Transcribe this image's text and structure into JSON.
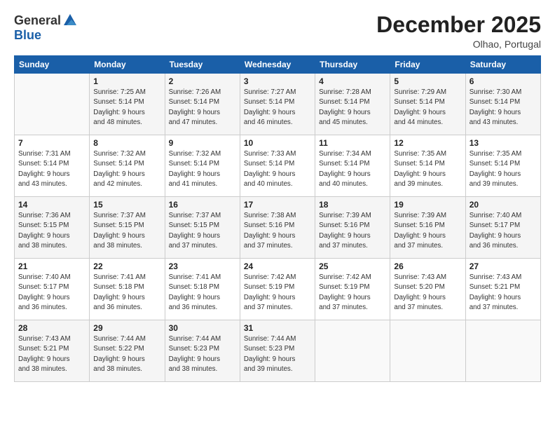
{
  "header": {
    "logo_general": "General",
    "logo_blue": "Blue",
    "month_title": "December 2025",
    "subtitle": "Olhao, Portugal"
  },
  "weekdays": [
    "Sunday",
    "Monday",
    "Tuesday",
    "Wednesday",
    "Thursday",
    "Friday",
    "Saturday"
  ],
  "weeks": [
    [
      {
        "day": "",
        "info": ""
      },
      {
        "day": "1",
        "info": "Sunrise: 7:25 AM\nSunset: 5:14 PM\nDaylight: 9 hours\nand 48 minutes."
      },
      {
        "day": "2",
        "info": "Sunrise: 7:26 AM\nSunset: 5:14 PM\nDaylight: 9 hours\nand 47 minutes."
      },
      {
        "day": "3",
        "info": "Sunrise: 7:27 AM\nSunset: 5:14 PM\nDaylight: 9 hours\nand 46 minutes."
      },
      {
        "day": "4",
        "info": "Sunrise: 7:28 AM\nSunset: 5:14 PM\nDaylight: 9 hours\nand 45 minutes."
      },
      {
        "day": "5",
        "info": "Sunrise: 7:29 AM\nSunset: 5:14 PM\nDaylight: 9 hours\nand 44 minutes."
      },
      {
        "day": "6",
        "info": "Sunrise: 7:30 AM\nSunset: 5:14 PM\nDaylight: 9 hours\nand 43 minutes."
      }
    ],
    [
      {
        "day": "7",
        "info": "Sunrise: 7:31 AM\nSunset: 5:14 PM\nDaylight: 9 hours\nand 43 minutes."
      },
      {
        "day": "8",
        "info": "Sunrise: 7:32 AM\nSunset: 5:14 PM\nDaylight: 9 hours\nand 42 minutes."
      },
      {
        "day": "9",
        "info": "Sunrise: 7:32 AM\nSunset: 5:14 PM\nDaylight: 9 hours\nand 41 minutes."
      },
      {
        "day": "10",
        "info": "Sunrise: 7:33 AM\nSunset: 5:14 PM\nDaylight: 9 hours\nand 40 minutes."
      },
      {
        "day": "11",
        "info": "Sunrise: 7:34 AM\nSunset: 5:14 PM\nDaylight: 9 hours\nand 40 minutes."
      },
      {
        "day": "12",
        "info": "Sunrise: 7:35 AM\nSunset: 5:14 PM\nDaylight: 9 hours\nand 39 minutes."
      },
      {
        "day": "13",
        "info": "Sunrise: 7:35 AM\nSunset: 5:14 PM\nDaylight: 9 hours\nand 39 minutes."
      }
    ],
    [
      {
        "day": "14",
        "info": "Sunrise: 7:36 AM\nSunset: 5:15 PM\nDaylight: 9 hours\nand 38 minutes."
      },
      {
        "day": "15",
        "info": "Sunrise: 7:37 AM\nSunset: 5:15 PM\nDaylight: 9 hours\nand 38 minutes."
      },
      {
        "day": "16",
        "info": "Sunrise: 7:37 AM\nSunset: 5:15 PM\nDaylight: 9 hours\nand 37 minutes."
      },
      {
        "day": "17",
        "info": "Sunrise: 7:38 AM\nSunset: 5:16 PM\nDaylight: 9 hours\nand 37 minutes."
      },
      {
        "day": "18",
        "info": "Sunrise: 7:39 AM\nSunset: 5:16 PM\nDaylight: 9 hours\nand 37 minutes."
      },
      {
        "day": "19",
        "info": "Sunrise: 7:39 AM\nSunset: 5:16 PM\nDaylight: 9 hours\nand 37 minutes."
      },
      {
        "day": "20",
        "info": "Sunrise: 7:40 AM\nSunset: 5:17 PM\nDaylight: 9 hours\nand 36 minutes."
      }
    ],
    [
      {
        "day": "21",
        "info": "Sunrise: 7:40 AM\nSunset: 5:17 PM\nDaylight: 9 hours\nand 36 minutes."
      },
      {
        "day": "22",
        "info": "Sunrise: 7:41 AM\nSunset: 5:18 PM\nDaylight: 9 hours\nand 36 minutes."
      },
      {
        "day": "23",
        "info": "Sunrise: 7:41 AM\nSunset: 5:18 PM\nDaylight: 9 hours\nand 36 minutes."
      },
      {
        "day": "24",
        "info": "Sunrise: 7:42 AM\nSunset: 5:19 PM\nDaylight: 9 hours\nand 37 minutes."
      },
      {
        "day": "25",
        "info": "Sunrise: 7:42 AM\nSunset: 5:19 PM\nDaylight: 9 hours\nand 37 minutes."
      },
      {
        "day": "26",
        "info": "Sunrise: 7:43 AM\nSunset: 5:20 PM\nDaylight: 9 hours\nand 37 minutes."
      },
      {
        "day": "27",
        "info": "Sunrise: 7:43 AM\nSunset: 5:21 PM\nDaylight: 9 hours\nand 37 minutes."
      }
    ],
    [
      {
        "day": "28",
        "info": "Sunrise: 7:43 AM\nSunset: 5:21 PM\nDaylight: 9 hours\nand 38 minutes."
      },
      {
        "day": "29",
        "info": "Sunrise: 7:44 AM\nSunset: 5:22 PM\nDaylight: 9 hours\nand 38 minutes."
      },
      {
        "day": "30",
        "info": "Sunrise: 7:44 AM\nSunset: 5:23 PM\nDaylight: 9 hours\nand 38 minutes."
      },
      {
        "day": "31",
        "info": "Sunrise: 7:44 AM\nSunset: 5:23 PM\nDaylight: 9 hours\nand 39 minutes."
      },
      {
        "day": "",
        "info": ""
      },
      {
        "day": "",
        "info": ""
      },
      {
        "day": "",
        "info": ""
      }
    ]
  ]
}
